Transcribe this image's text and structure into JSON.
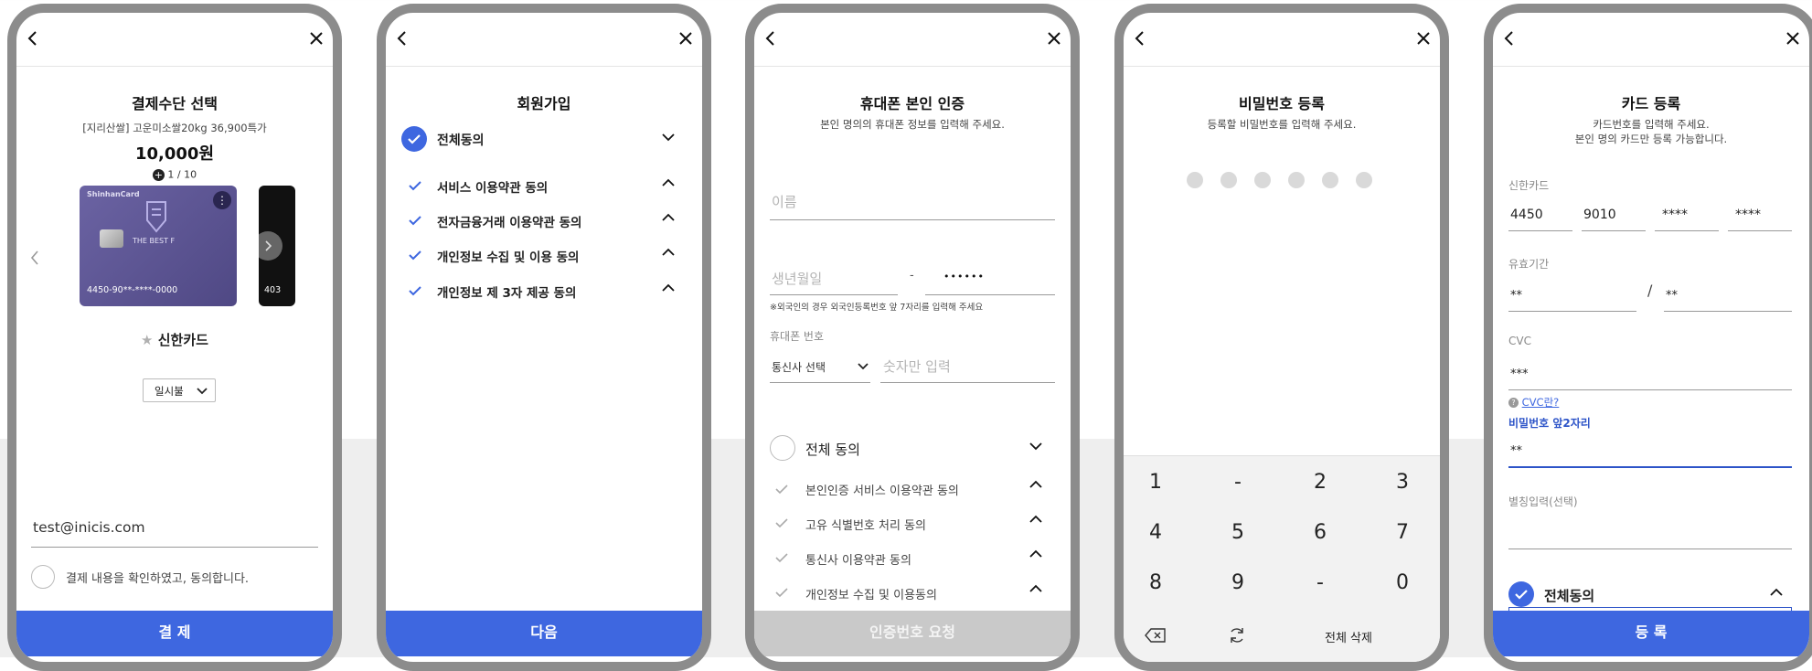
{
  "screen1": {
    "title": "결제수단 선택",
    "product": "[지리산쌀] 고운미소쌀20kg 36,900특가",
    "price": "10,000원",
    "page_indicator": "1 / 10",
    "card_brand": "ShinhanCard",
    "card_caption": "THE BEST F",
    "card_number": "4450-90**-****-0000",
    "next_card_number": "403",
    "card_name": "신한카드",
    "installment": "일시불",
    "email": "test@inicis.com",
    "consent": "결제 내용을 확인하였고, 동의합니다.",
    "button": "결 제"
  },
  "screen2": {
    "title": "회원가입",
    "all_agree": "전체동의",
    "items": [
      {
        "label": "서비스 이용약관 동의"
      },
      {
        "label": "전자금융거래 이용약관 동의"
      },
      {
        "label": "개인정보 수집 및 이용 동의"
      },
      {
        "label": "개인정보 제 3자 제공 동의"
      }
    ],
    "button": "다음"
  },
  "screen3": {
    "title": "휴대폰 본인 인증",
    "subtitle": "본인 명의의 휴대폰 정보를 입력해 주세요.",
    "name_placeholder": "이름",
    "birth_placeholder": "생년월일",
    "dash": "-",
    "masked": "••••••",
    "foreign_note": "※외국인의 경우 외국인등록번호 앞 7자리를 입력해 주세요",
    "phone_label": "휴대폰 번호",
    "carrier": "통신사 선택",
    "number_placeholder": "숫자만 입력",
    "all_agree": "전체 동의",
    "items": [
      {
        "label": "본인인증 서비스 이용약관 동의"
      },
      {
        "label": "고유 식별번호 처리 동의"
      },
      {
        "label": "통신사 이용약관 동의"
      },
      {
        "label": "개인정보 수집 및 이용동의"
      }
    ],
    "button": "인증번호 요청"
  },
  "screen4": {
    "title": "비밀번호 등록",
    "subtitle": "등록할 비밀번호를 입력해 주세요.",
    "pin_length": 6,
    "keys": [
      "1",
      "-",
      "2",
      "3",
      "4",
      "5",
      "6",
      "7",
      "8",
      "9",
      "-",
      "0"
    ],
    "delete_all": "전체 삭제"
  },
  "screen5": {
    "title": "카드 등록",
    "subtitle_1": "카드번호를 입력해 주세요.",
    "subtitle_2": "본인 명의 카드만 등록 가능합니다.",
    "card_label": "신한카드",
    "card_parts": [
      "4450",
      "9010",
      "****",
      "****"
    ],
    "expiry_label": "유효기간",
    "expiry_month": "**",
    "slash": "/",
    "expiry_year": "**",
    "cvc_label": "CVC",
    "cvc_value": "***",
    "cvc_help": "CVC란?",
    "pw_label": "비밀번호 앞2자리",
    "pw_value": "**",
    "nickname_label": "별칭입력(선택)",
    "all_agree": "전체동의",
    "button": "등 록"
  },
  "colors": {
    "primary": "#3e67e0",
    "disabled": "#c9c9c9",
    "frame": "#8c8c8c"
  }
}
